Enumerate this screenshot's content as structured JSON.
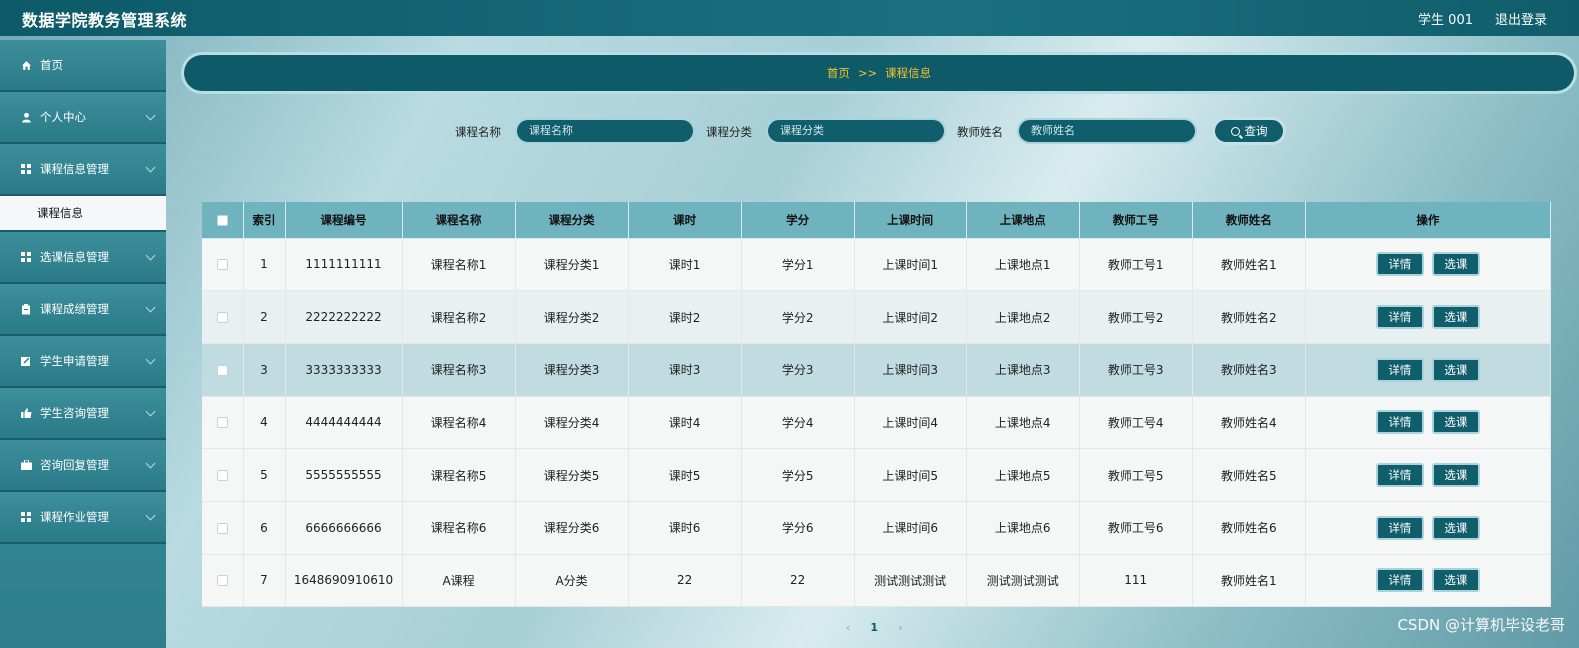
{
  "header": {
    "title": "数据学院教务管理系统",
    "user": "学生 001",
    "logout": "退出登录"
  },
  "sidebar": {
    "items": [
      {
        "label": "首页",
        "icon": "home-icon"
      },
      {
        "label": "个人中心",
        "icon": "user-icon"
      },
      {
        "label": "课程信息管理",
        "icon": "grid-icon"
      },
      {
        "label": "选课信息管理",
        "icon": "grid-icon"
      },
      {
        "label": "课程成绩管理",
        "icon": "clipboard-icon"
      },
      {
        "label": "学生申请管理",
        "icon": "edit-icon"
      },
      {
        "label": "学生咨询管理",
        "icon": "thumb-icon"
      },
      {
        "label": "咨询回复管理",
        "icon": "briefcase-icon"
      },
      {
        "label": "课程作业管理",
        "icon": "grid-icon"
      }
    ],
    "sub_item": "课程信息"
  },
  "breadcrumb": {
    "home": "首页",
    "sep": ">>",
    "current": "课程信息"
  },
  "search": {
    "course_name_label": "课程名称",
    "course_name_placeholder": "课程名称",
    "category_label": "课程分类",
    "category_placeholder": "课程分类",
    "teacher_label": "教师姓名",
    "teacher_placeholder": "教师姓名",
    "button": "查询"
  },
  "table": {
    "columns": [
      "索引",
      "课程编号",
      "课程名称",
      "课程分类",
      "课时",
      "学分",
      "上课时间",
      "上课地点",
      "教师工号",
      "教师姓名",
      "操作"
    ],
    "rows": [
      [
        "1",
        "1111111111",
        "课程名称1",
        "课程分类1",
        "课时1",
        "学分1",
        "上课时间1",
        "上课地点1",
        "教师工号1",
        "教师姓名1"
      ],
      [
        "2",
        "2222222222",
        "课程名称2",
        "课程分类2",
        "课时2",
        "学分2",
        "上课时间2",
        "上课地点2",
        "教师工号2",
        "教师姓名2"
      ],
      [
        "3",
        "3333333333",
        "课程名称3",
        "课程分类3",
        "课时3",
        "学分3",
        "上课时间3",
        "上课地点3",
        "教师工号3",
        "教师姓名3"
      ],
      [
        "4",
        "4444444444",
        "课程名称4",
        "课程分类4",
        "课时4",
        "学分4",
        "上课时间4",
        "上课地点4",
        "教师工号4",
        "教师姓名4"
      ],
      [
        "5",
        "5555555555",
        "课程名称5",
        "课程分类5",
        "课时5",
        "学分5",
        "上课时间5",
        "上课地点5",
        "教师工号5",
        "教师姓名5"
      ],
      [
        "6",
        "6666666666",
        "课程名称6",
        "课程分类6",
        "课时6",
        "学分6",
        "上课时间6",
        "上课地点6",
        "教师工号6",
        "教师姓名6"
      ],
      [
        "7",
        "1648690910610",
        "A课程",
        "A分类",
        "22",
        "22",
        "测试测试测试",
        "测试测试测试",
        "111",
        "教师姓名1"
      ]
    ],
    "detail_button": "详情",
    "select_button": "选课"
  },
  "pager": {
    "prev": "‹",
    "current": "1",
    "next": "›"
  },
  "watermark": "CSDN @计算机毕设老哥",
  "colors": {
    "primary": "#105e6c",
    "header_row": "#6fb3be",
    "crumb_text": "#f2c12e"
  }
}
